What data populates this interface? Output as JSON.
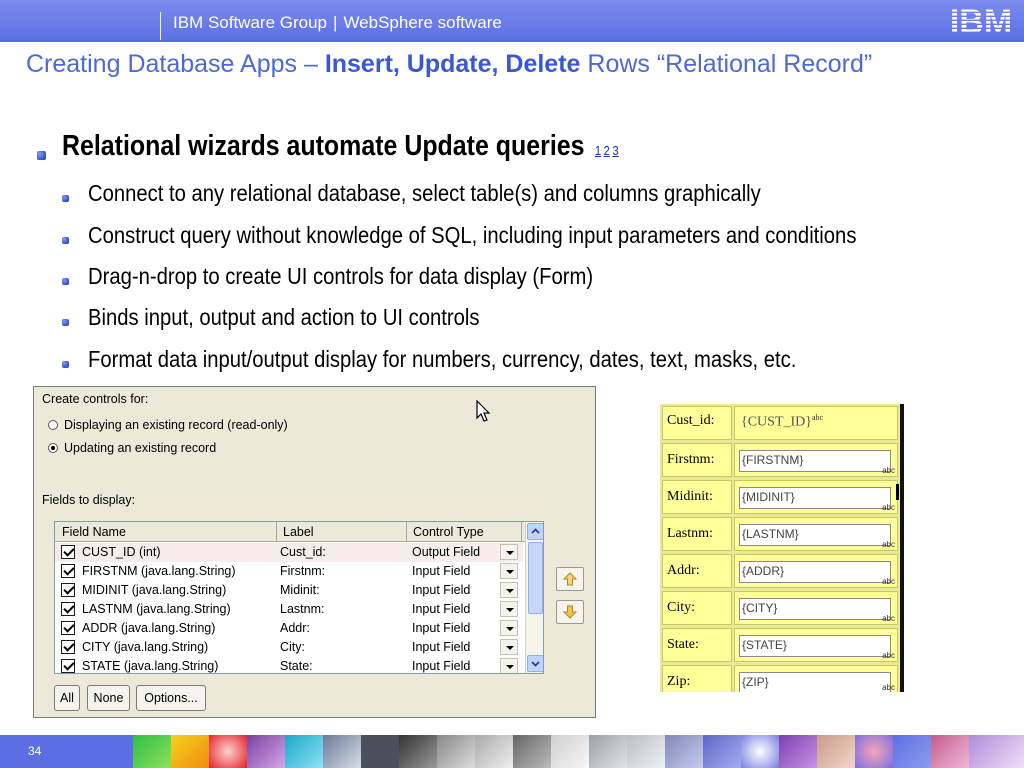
{
  "header": {
    "group": "IBM Software Group",
    "separator": "|",
    "product": "WebSphere software",
    "logo_text": "IBM"
  },
  "title": {
    "prefix": "Creating Database Apps – ",
    "bold": "Insert, Update, Delete",
    "suffix": " Rows “Relational Record”"
  },
  "bullets": {
    "main": "Relational wizards automate Update queries",
    "refs": [
      "1",
      "2",
      "3"
    ],
    "items": [
      "Connect to any relational database, select table(s) and columns graphically",
      "Construct query without knowledge of SQL, including input parameters and conditions",
      "Drag-n-drop to create UI controls for data display (Form)",
      "Binds input, output and action to UI controls",
      "Format data input/output display for numbers, currency, dates, text, masks, etc."
    ]
  },
  "dialog": {
    "create_label": "Create controls for:",
    "radio_options": [
      {
        "label": "Displaying an existing record (read-only)",
        "selected": false
      },
      {
        "label": "Updating an existing record",
        "selected": true
      }
    ],
    "fields_label": "Fields to display:",
    "columns": [
      "Field Name",
      "Label",
      "Control Type"
    ],
    "rows": [
      {
        "field": "CUST_ID (int)",
        "label": "Cust_id:",
        "control": "Output Field",
        "checked": true
      },
      {
        "field": "FIRSTNM (java.lang.String)",
        "label": "Firstnm:",
        "control": "Input Field",
        "checked": true
      },
      {
        "field": "MIDINIT (java.lang.String)",
        "label": "Midinit:",
        "control": "Input Field",
        "checked": true
      },
      {
        "field": "LASTNM (java.lang.String)",
        "label": "Lastnm:",
        "control": "Input Field",
        "checked": true
      },
      {
        "field": "ADDR (java.lang.String)",
        "label": "Addr:",
        "control": "Input Field",
        "checked": true
      },
      {
        "field": "CITY (java.lang.String)",
        "label": "City:",
        "control": "Input Field",
        "checked": true
      },
      {
        "field": "STATE (java.lang.String)",
        "label": "State:",
        "control": "Input Field",
        "checked": true
      }
    ],
    "buttons": {
      "all": "All",
      "none": "None",
      "options": "Options..."
    }
  },
  "form": {
    "rows": [
      {
        "label": "Cust_id:",
        "value": "{CUST_ID}",
        "suffix": "abc",
        "output": true
      },
      {
        "label": "Firstnm:",
        "value": "{FIRSTNM}",
        "suffix": "abc"
      },
      {
        "label": "Midinit:",
        "value": "{MIDINIT}",
        "suffix": "abc"
      },
      {
        "label": "Lastnm:",
        "value": "{LASTNM}",
        "suffix": "abc"
      },
      {
        "label": "Addr:",
        "value": "{ADDR}",
        "suffix": "abc"
      },
      {
        "label": "City:",
        "value": "{CITY}",
        "suffix": "abc"
      },
      {
        "label": "State:",
        "value": "{STATE}",
        "suffix": "abc"
      },
      {
        "label": "Zip:",
        "value": "{ZIP}",
        "suffix": "abc"
      }
    ]
  },
  "footer": {
    "page": "34"
  },
  "colors": {
    "accent": "#5b6fe2",
    "title": "#4d68d9",
    "form_bg": "#ffff9a"
  }
}
